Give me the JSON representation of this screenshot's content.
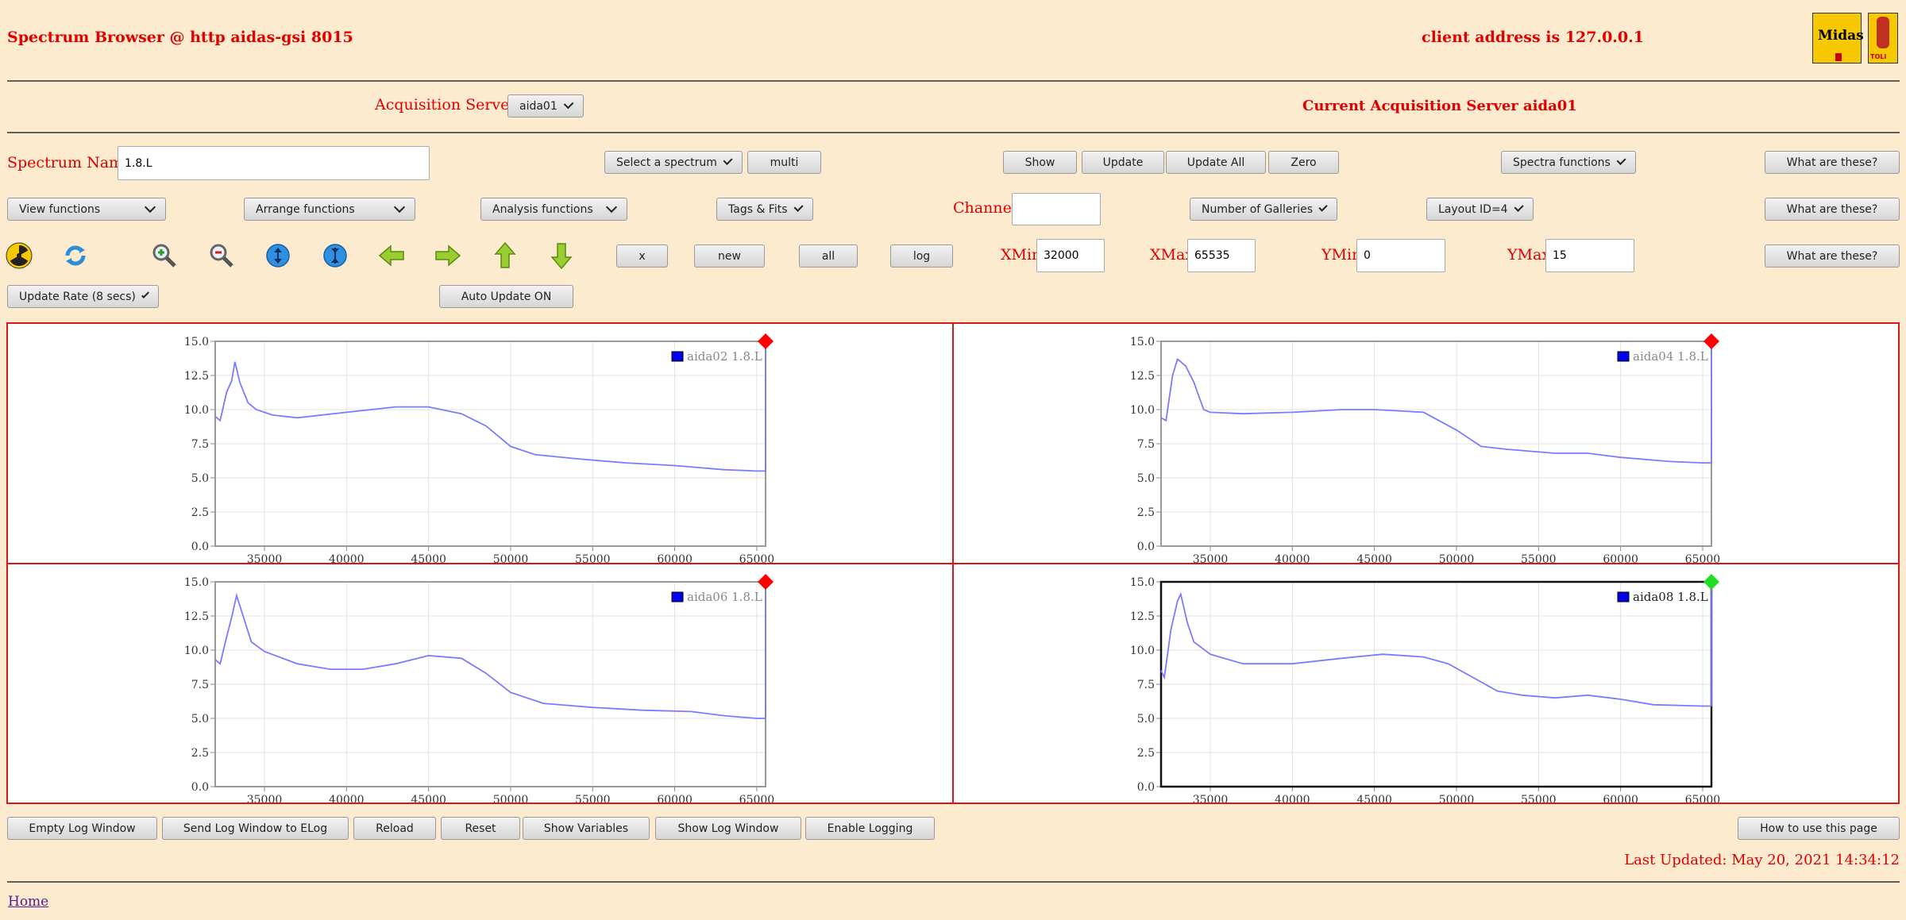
{
  "header": {
    "title": "Spectrum Browser @ http aidas-gsi 8015",
    "client": "client address is 127.0.0.1",
    "logo_midas": "Midas",
    "logo_toli": "TOLI"
  },
  "acq": {
    "label": "Acquisition Servers",
    "server_select": "aida01",
    "current": "Current Acquisition Server aida01"
  },
  "row1": {
    "spectrum_label": "Spectrum Name:",
    "spectrum_value": "1.8.L",
    "select_spectrum": "Select a spectrum",
    "multi": "multi",
    "show": "Show",
    "update": "Update",
    "update_all": "Update All",
    "zero": "Zero",
    "spectra_functions": "Spectra functions",
    "what": "What are these?"
  },
  "row2": {
    "view": "View functions",
    "arrange": "Arrange functions",
    "analysis": "Analysis functions",
    "tags": "Tags & Fits",
    "channel_label": "Channel:",
    "channel_value": "",
    "galleries": "Number of Galleries",
    "layout": "Layout ID=4",
    "what": "What are these?"
  },
  "row3": {
    "x": "x",
    "new": "new",
    "all": "all",
    "log": "log",
    "xmin_label": "XMin",
    "xmin": "32000",
    "xmax_label": "XMax",
    "xmax": "65535",
    "ymin_label": "YMin",
    "ymin": "0",
    "ymax_label": "YMax",
    "ymax": "15",
    "what": "What are these?"
  },
  "row4": {
    "update_rate": "Update Rate (8 secs)",
    "auto_update": "Auto Update ON"
  },
  "footer_buttons": {
    "empty_log": "Empty Log Window",
    "send_log": "Send Log Window to ELog",
    "reload": "Reload",
    "reset": "Reset",
    "show_vars": "Show Variables",
    "show_log": "Show Log Window",
    "enable_logging": "Enable Logging",
    "how_to": "How to use this page"
  },
  "last_updated": "Last Updated: May 20, 2021 14:34:12",
  "home": "Home",
  "colors": {
    "accent": "#e00000",
    "panel_border": "#d81818",
    "line": "#7b7bff",
    "status_red": "#ff0000",
    "status_green": "#22dd22"
  },
  "chart_data": [
    {
      "type": "line",
      "legend": "aida02 1.8.L",
      "status": "red",
      "xlim": [
        32000,
        65535
      ],
      "ylim": [
        0,
        15
      ],
      "xticks": [
        "35000",
        "40000",
        "45000",
        "50000",
        "55000",
        "60000",
        "65000"
      ],
      "yticks": [
        "0.0",
        "2.5",
        "5.0",
        "7.5",
        "10.0",
        "12.5",
        "15.0"
      ],
      "x": [
        32000,
        32300,
        32700,
        33000,
        33200,
        33500,
        34000,
        34500,
        35500,
        37000,
        40000,
        43000,
        45000,
        47000,
        48500,
        50000,
        51500,
        54000,
        57000,
        60000,
        63000,
        65000,
        65535
      ],
      "y": [
        9.5,
        9.2,
        11.3,
        12.1,
        13.5,
        12.0,
        10.5,
        10.0,
        9.6,
        9.4,
        9.8,
        10.2,
        10.2,
        9.7,
        8.8,
        7.3,
        6.7,
        6.4,
        6.1,
        5.9,
        5.6,
        5.5,
        5.5
      ]
    },
    {
      "type": "line",
      "legend": "aida04 1.8.L",
      "status": "red",
      "xlim": [
        32000,
        65535
      ],
      "ylim": [
        0,
        15
      ],
      "xticks": [
        "35000",
        "40000",
        "45000",
        "50000",
        "55000",
        "60000",
        "65000"
      ],
      "yticks": [
        "0.0",
        "2.5",
        "5.0",
        "7.5",
        "10.0",
        "12.5",
        "15.0"
      ],
      "x": [
        32000,
        32300,
        32700,
        33000,
        33500,
        34000,
        34300,
        34600,
        35000,
        37000,
        40000,
        43000,
        45000,
        48000,
        50000,
        51500,
        53000,
        56000,
        58000,
        60000,
        63000,
        65000,
        65535
      ],
      "y": [
        9.4,
        9.2,
        12.5,
        13.7,
        13.2,
        12.0,
        11.0,
        10.0,
        9.8,
        9.7,
        9.8,
        10.0,
        10.0,
        9.8,
        8.5,
        7.3,
        7.1,
        6.8,
        6.8,
        6.5,
        6.2,
        6.1,
        6.1
      ]
    },
    {
      "type": "line",
      "legend": "aida06 1.8.L",
      "status": "red",
      "xlim": [
        32000,
        65535
      ],
      "ylim": [
        0,
        15
      ],
      "xticks": [
        "35000",
        "40000",
        "45000",
        "50000",
        "55000",
        "60000",
        "65000"
      ],
      "yticks": [
        "0.0",
        "2.5",
        "5.0",
        "7.5",
        "10.0",
        "12.5",
        "15.0"
      ],
      "x": [
        32000,
        32300,
        32700,
        33000,
        33300,
        33700,
        34200,
        35000,
        37000,
        39000,
        41000,
        43000,
        45000,
        47000,
        48500,
        50000,
        52000,
        55000,
        58000,
        61000,
        63000,
        65000,
        65535
      ],
      "y": [
        9.3,
        9.0,
        11.0,
        12.4,
        14.0,
        12.5,
        10.6,
        9.9,
        9.0,
        8.6,
        8.6,
        9.0,
        9.6,
        9.4,
        8.3,
        6.9,
        6.1,
        5.8,
        5.6,
        5.5,
        5.2,
        5.0,
        5.0
      ]
    },
    {
      "type": "line",
      "legend": "aida08 1.8.L",
      "status": "green",
      "xlim": [
        32000,
        65535
      ],
      "ylim": [
        0,
        15
      ],
      "xticks": [
        "35000",
        "40000",
        "45000",
        "50000",
        "55000",
        "60000",
        "65000"
      ],
      "yticks": [
        "0.0",
        "2.5",
        "5.0",
        "7.5",
        "10.0",
        "12.5",
        "15.0"
      ],
      "x": [
        32000,
        32200,
        32600,
        33000,
        33200,
        33600,
        34000,
        35000,
        37000,
        40000,
        43000,
        45500,
        48000,
        49500,
        51000,
        52500,
        54000,
        56000,
        58000,
        60000,
        62000,
        65000,
        65535
      ],
      "y": [
        8.5,
        8.0,
        11.5,
        13.6,
        14.1,
        12.0,
        10.6,
        9.7,
        9.0,
        9.0,
        9.4,
        9.7,
        9.5,
        9.0,
        8.0,
        7.0,
        6.7,
        6.5,
        6.7,
        6.4,
        6.0,
        5.9,
        5.9
      ]
    }
  ]
}
